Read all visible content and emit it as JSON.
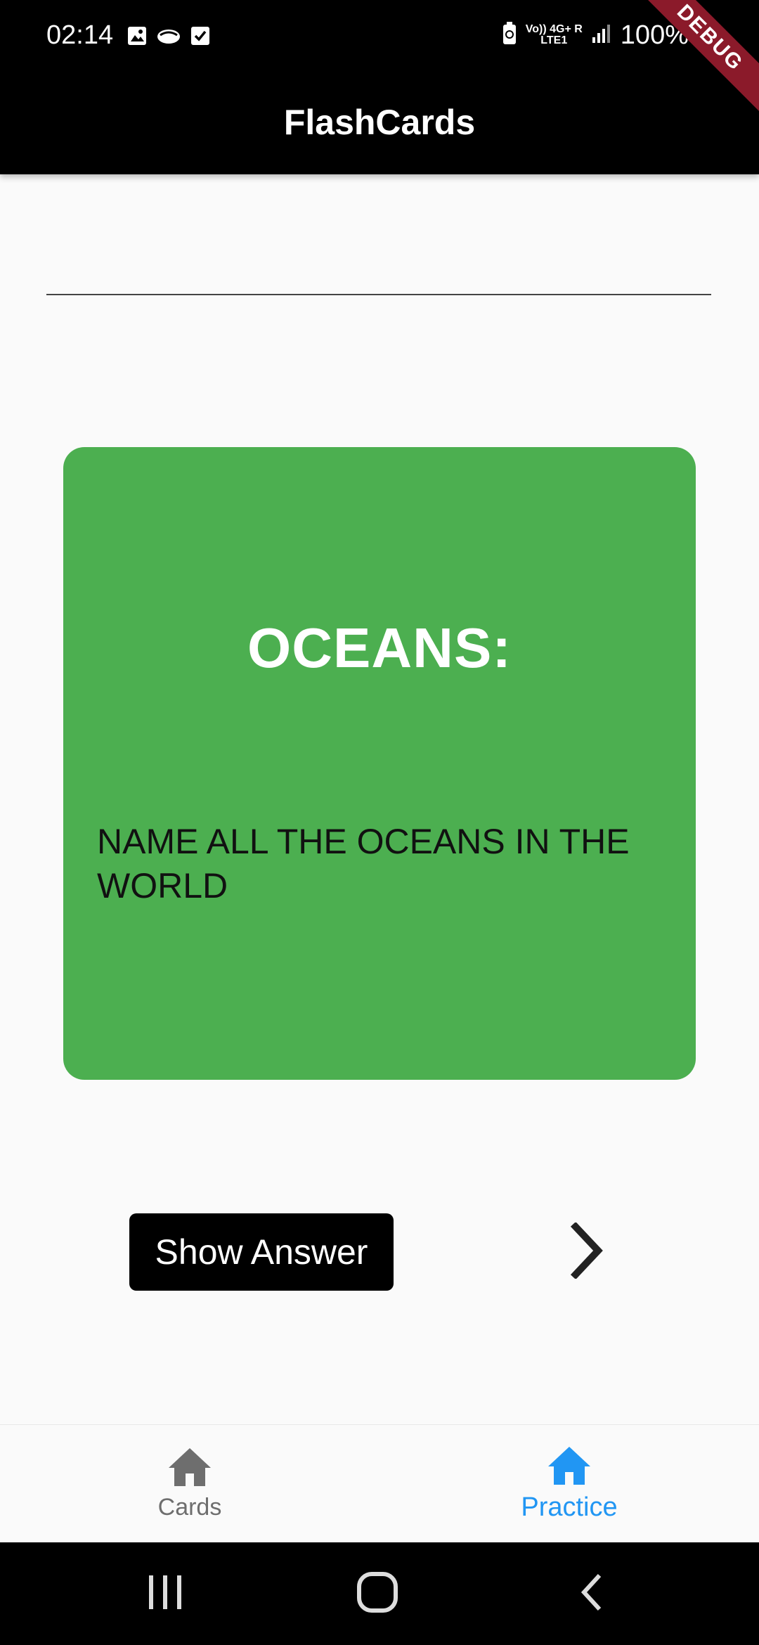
{
  "status_bar": {
    "time": "02:14",
    "network_top": "Vo)) 4G+ R",
    "network_sub": "LTE1",
    "battery": "100%"
  },
  "debug_banner": "DEBUG",
  "app_bar": {
    "title": "FlashCards"
  },
  "card": {
    "title": "OCEANS:",
    "question": "NAME ALL THE OCEANS IN THE WORLD",
    "color": "#4caf50"
  },
  "actions": {
    "show_answer_label": "Show Answer",
    "next_icon": "chevron-right-icon"
  },
  "bottom_nav": {
    "items": [
      {
        "label": "Cards",
        "icon": "home-icon",
        "active": false
      },
      {
        "label": "Practice",
        "icon": "home-icon",
        "active": true
      }
    ],
    "active_color": "#2196f3",
    "inactive_color": "#6e6e6e"
  },
  "system_nav": {
    "buttons": [
      "recents-icon",
      "home-icon",
      "back-icon"
    ]
  }
}
